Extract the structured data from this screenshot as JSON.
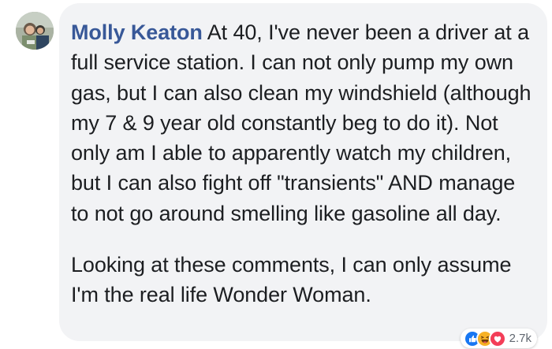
{
  "comment": {
    "author": "Molly Keaton",
    "paragraphs": [
      "At 40, I've never been a driver at a full service station. I can not only pump my own gas, but I can also clean my windshield (although my 7 & 9 year old constantly beg to do it). Not only am I able to apparently watch my children, but I can also fight off \"transients\" AND manage to not go around smelling like gasoline all day.",
      "Looking at these comments, I can only assume I'm the real life Wonder Woman."
    ],
    "reactions": {
      "icons": [
        "like-icon",
        "haha-icon",
        "love-icon"
      ],
      "count": "2.7k"
    }
  },
  "colors": {
    "author": "#385898",
    "bubble": "#f2f3f5",
    "text": "#1c1e21",
    "like": "#1877f2",
    "haha": "#f7b125",
    "love": "#f33e58"
  }
}
